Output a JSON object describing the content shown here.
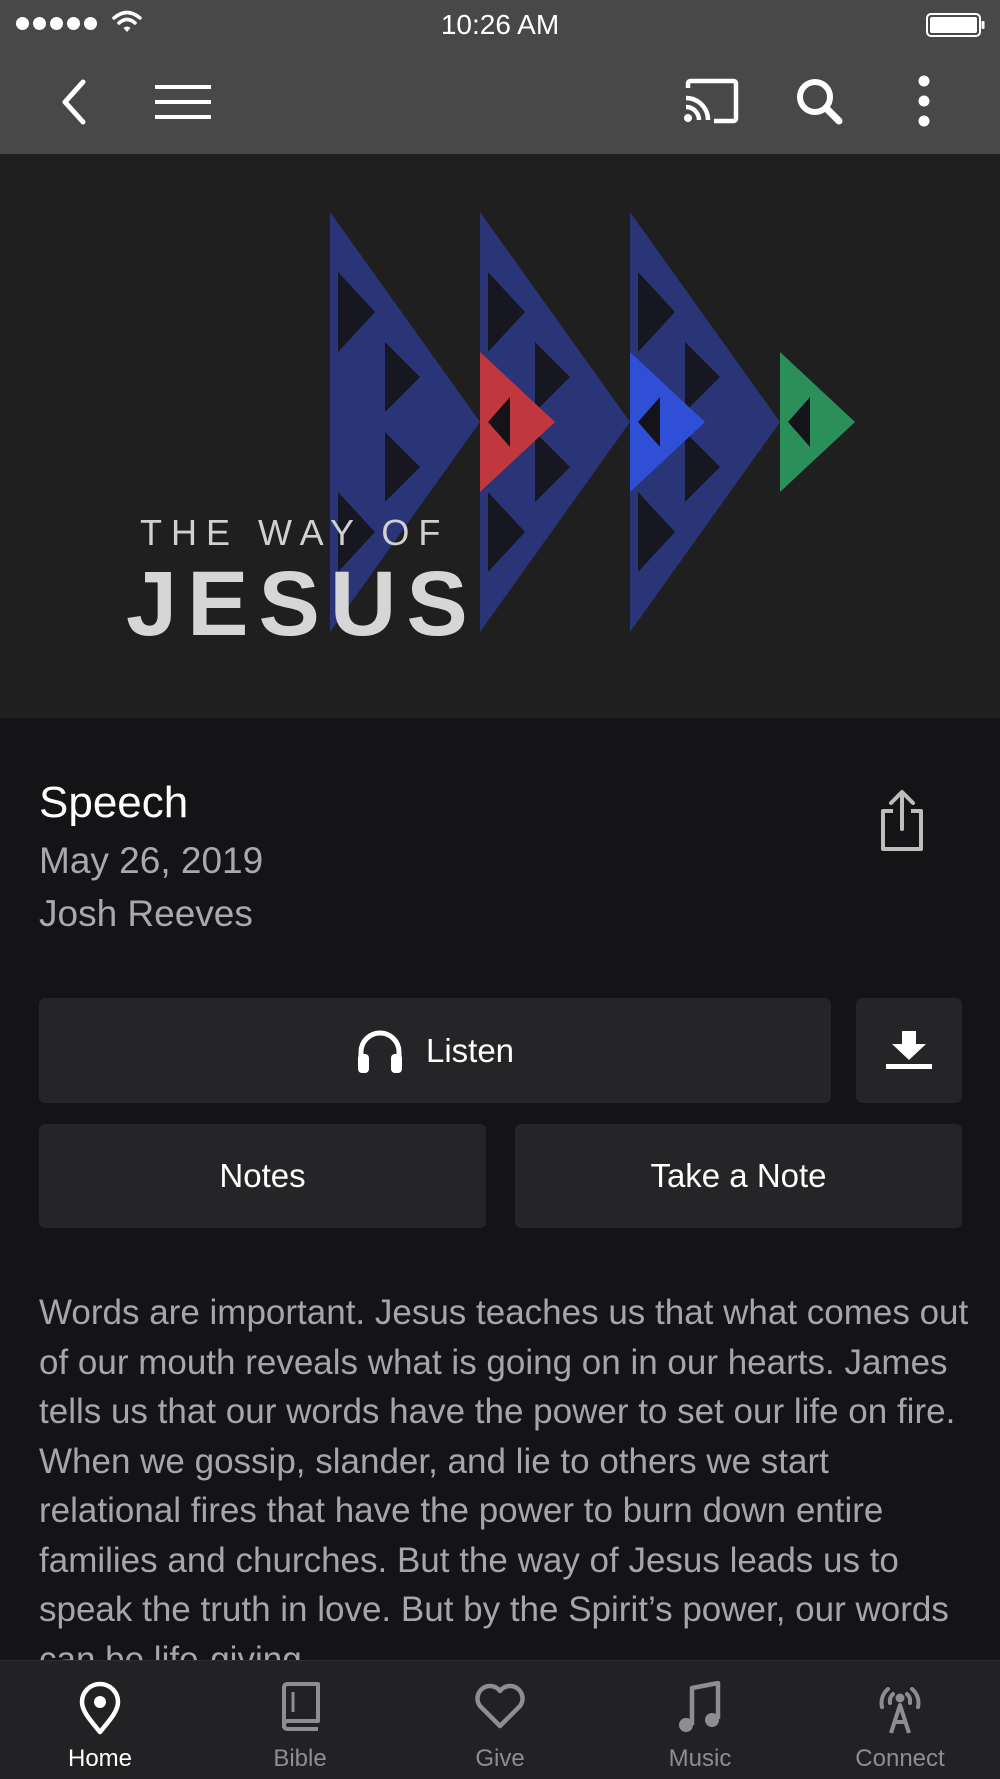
{
  "status_bar": {
    "time": "10:26 AM",
    "signal_icon": "signal-dots-icon",
    "wifi_icon": "wifi-icon",
    "battery_icon": "battery-icon"
  },
  "top_nav": {
    "back_icon": "chevron-left-icon",
    "menu_icon": "hamburger-menu-icon",
    "cast_icon": "cast-icon",
    "search_icon": "search-icon",
    "more_icon": "more-vertical-icon",
    "background": "#484848"
  },
  "hero": {
    "line1": "THE WAY OF",
    "line2": "JESUS",
    "colors": {
      "blue": "#2b3a86",
      "red": "#c0383e",
      "bright_blue": "#2f4fd6",
      "green": "#2b8f5a"
    }
  },
  "sermon": {
    "title": "Speech",
    "date": "May 26, 2019",
    "speaker": "Josh Reeves",
    "share_icon": "share-icon"
  },
  "actions": {
    "listen_label": "Listen",
    "listen_icon": "headphones-icon",
    "download_icon": "download-icon",
    "notes_label": "Notes",
    "take_note_label": "Take a Note"
  },
  "description": "Words are important. Jesus teaches us that what comes out of our mouth reveals what is going on in our hearts. James tells us that our words have the power to set our life on fire. When we gossip, slander, and lie to others we start relational fires that have the power to burn down entire families and churches. But the way of Jesus leads us to speak the truth in love. But by the Spirit’s power, our words can be life-giving",
  "tab_bar": {
    "tabs": [
      {
        "label": "Home",
        "icon": "location-pin-icon",
        "active": true
      },
      {
        "label": "Bible",
        "icon": "book-icon",
        "active": false
      },
      {
        "label": "Give",
        "icon": "heart-icon",
        "active": false
      },
      {
        "label": "Music",
        "icon": "music-note-icon",
        "active": false
      },
      {
        "label": "Connect",
        "icon": "broadcast-icon",
        "active": false
      }
    ]
  }
}
